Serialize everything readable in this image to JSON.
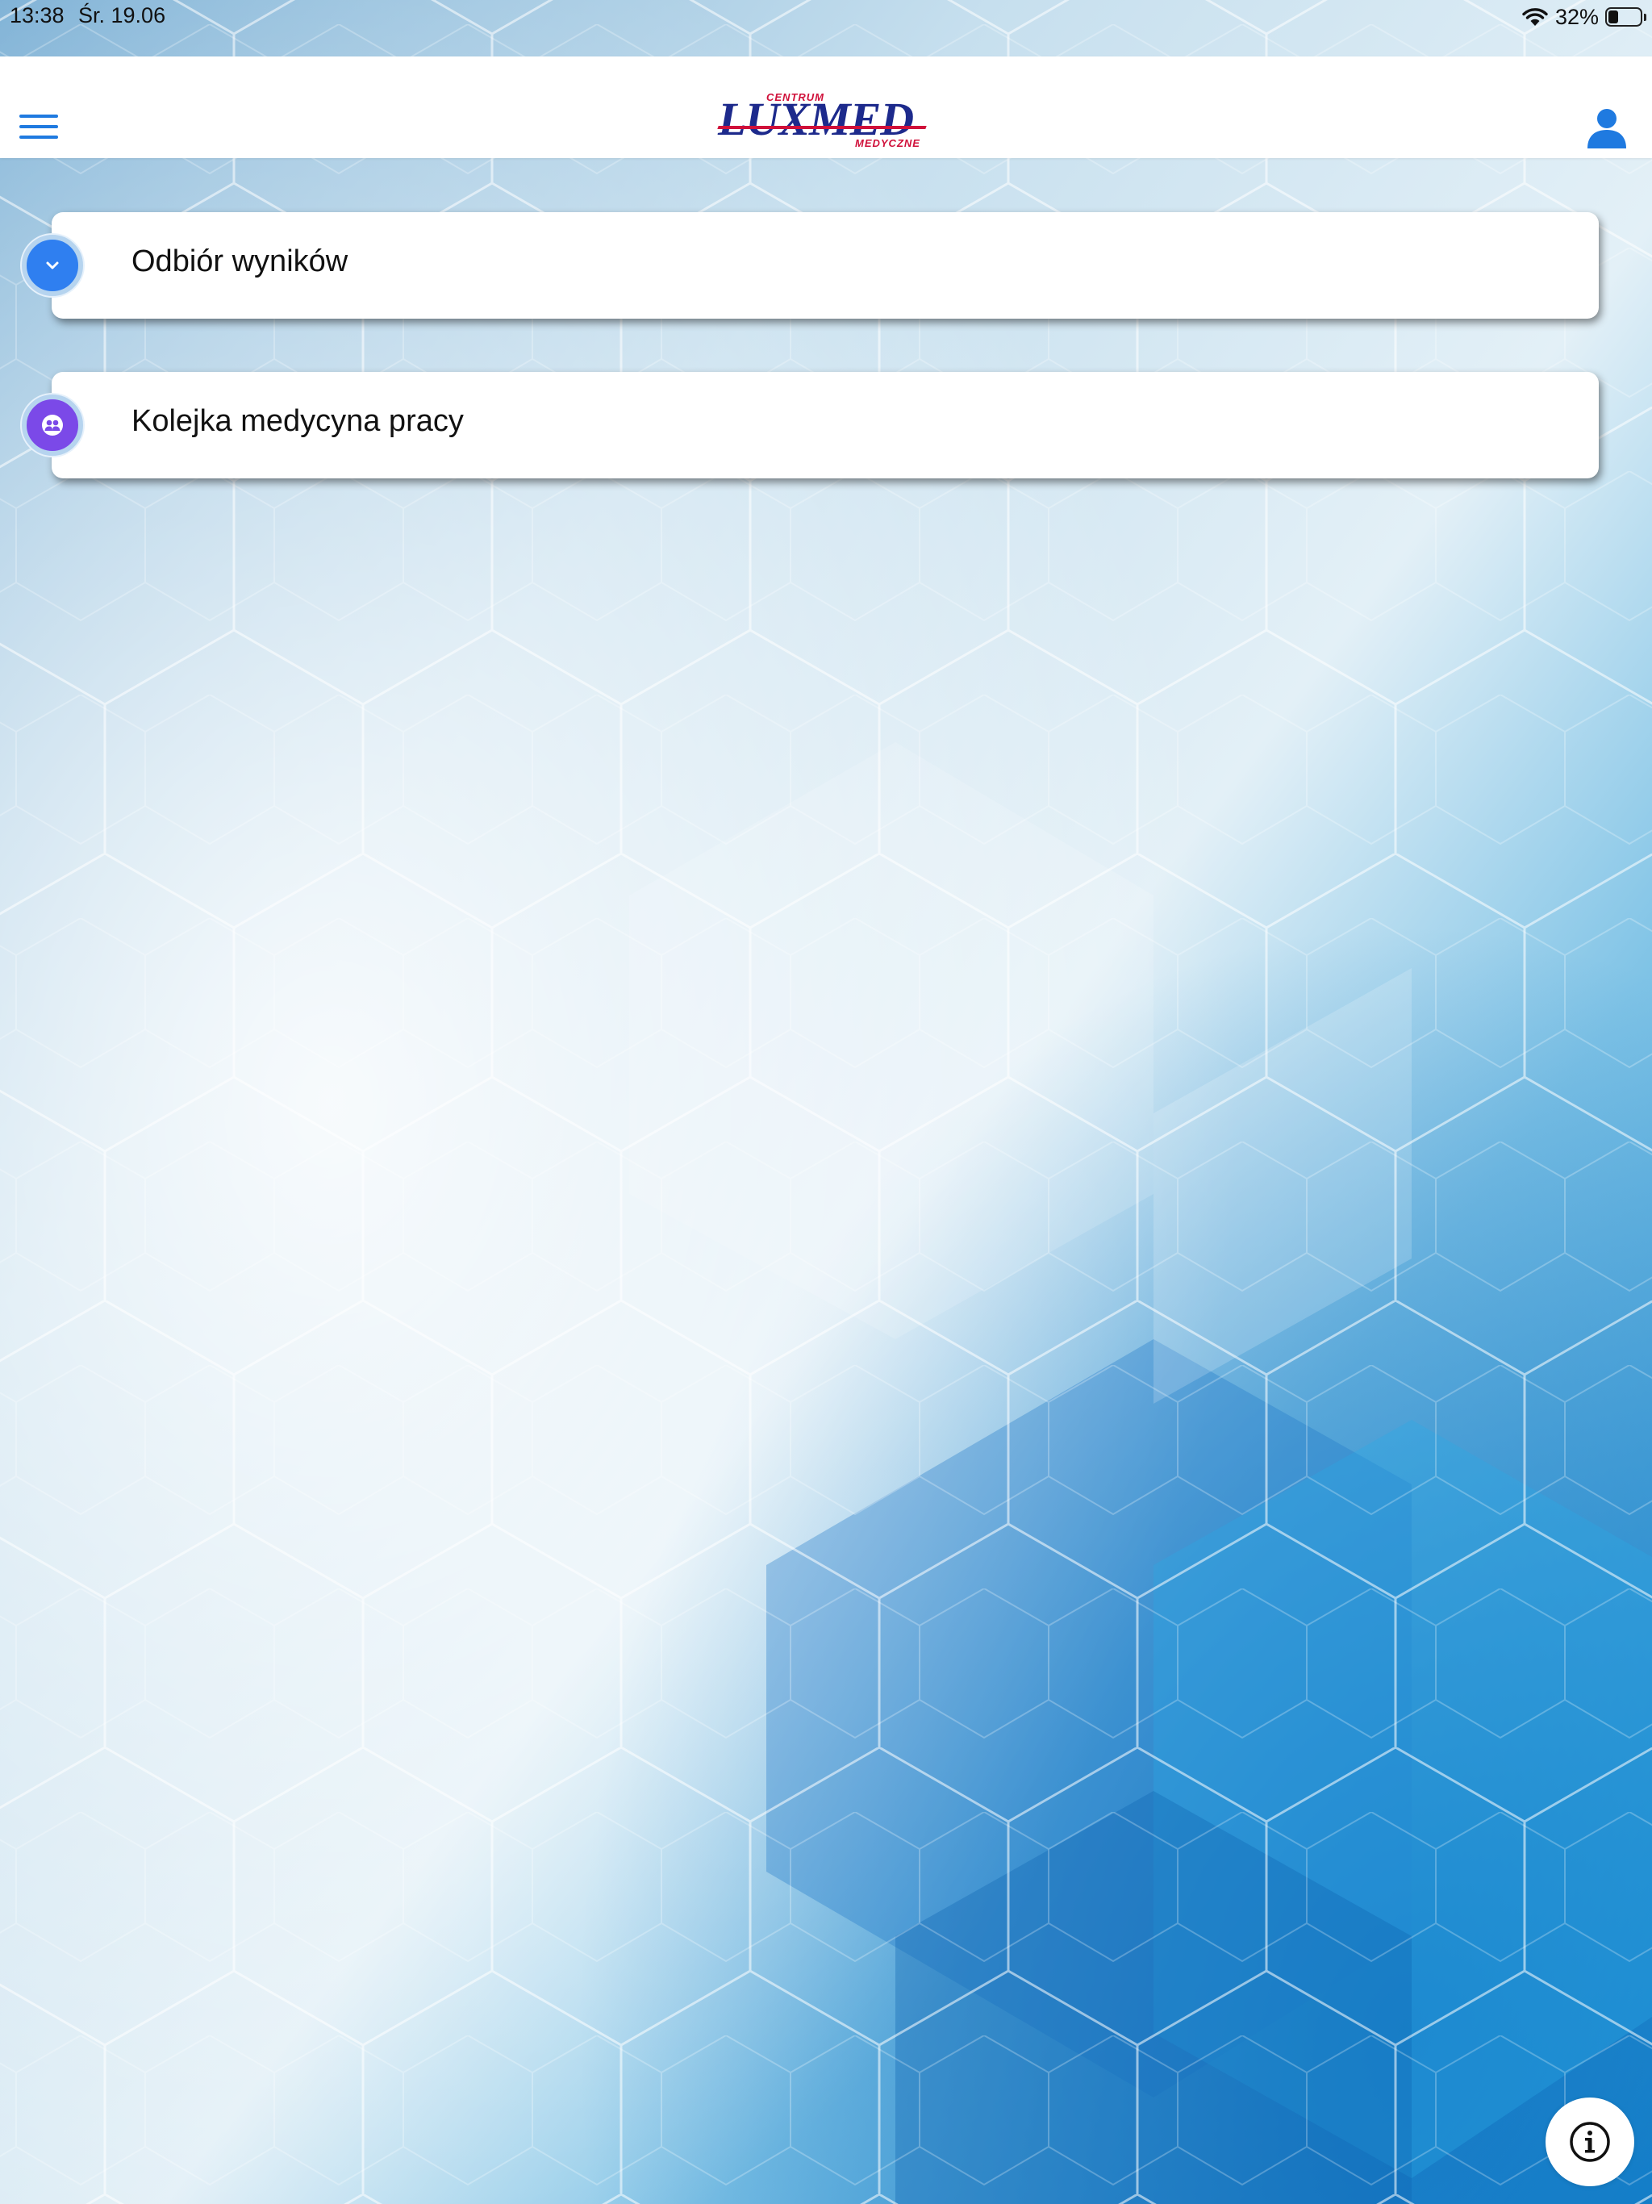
{
  "status_bar": {
    "time": "13:38",
    "date": "Śr. 19.06",
    "battery": "32%",
    "battery_level": 0.32
  },
  "header": {
    "logo_top": "CENTRUM",
    "logo_main": "LUXMED",
    "logo_bottom": "MEDYCZNE",
    "menu_icon": "hamburger-menu-icon",
    "profile_icon": "user-profile-icon"
  },
  "menu": {
    "items": [
      {
        "label": "Odbiór wyników",
        "icon": "chevron-down-icon",
        "color": "#2f7ff0"
      },
      {
        "label": "Kolejka medycyna pracy",
        "icon": "people-icon",
        "color": "#7b49e8"
      }
    ]
  },
  "footer": {
    "info_icon": "info-icon"
  },
  "colors": {
    "accent_blue": "#1f7ae0",
    "logo_navy": "#1d2a8c",
    "logo_red": "#d0103a"
  }
}
